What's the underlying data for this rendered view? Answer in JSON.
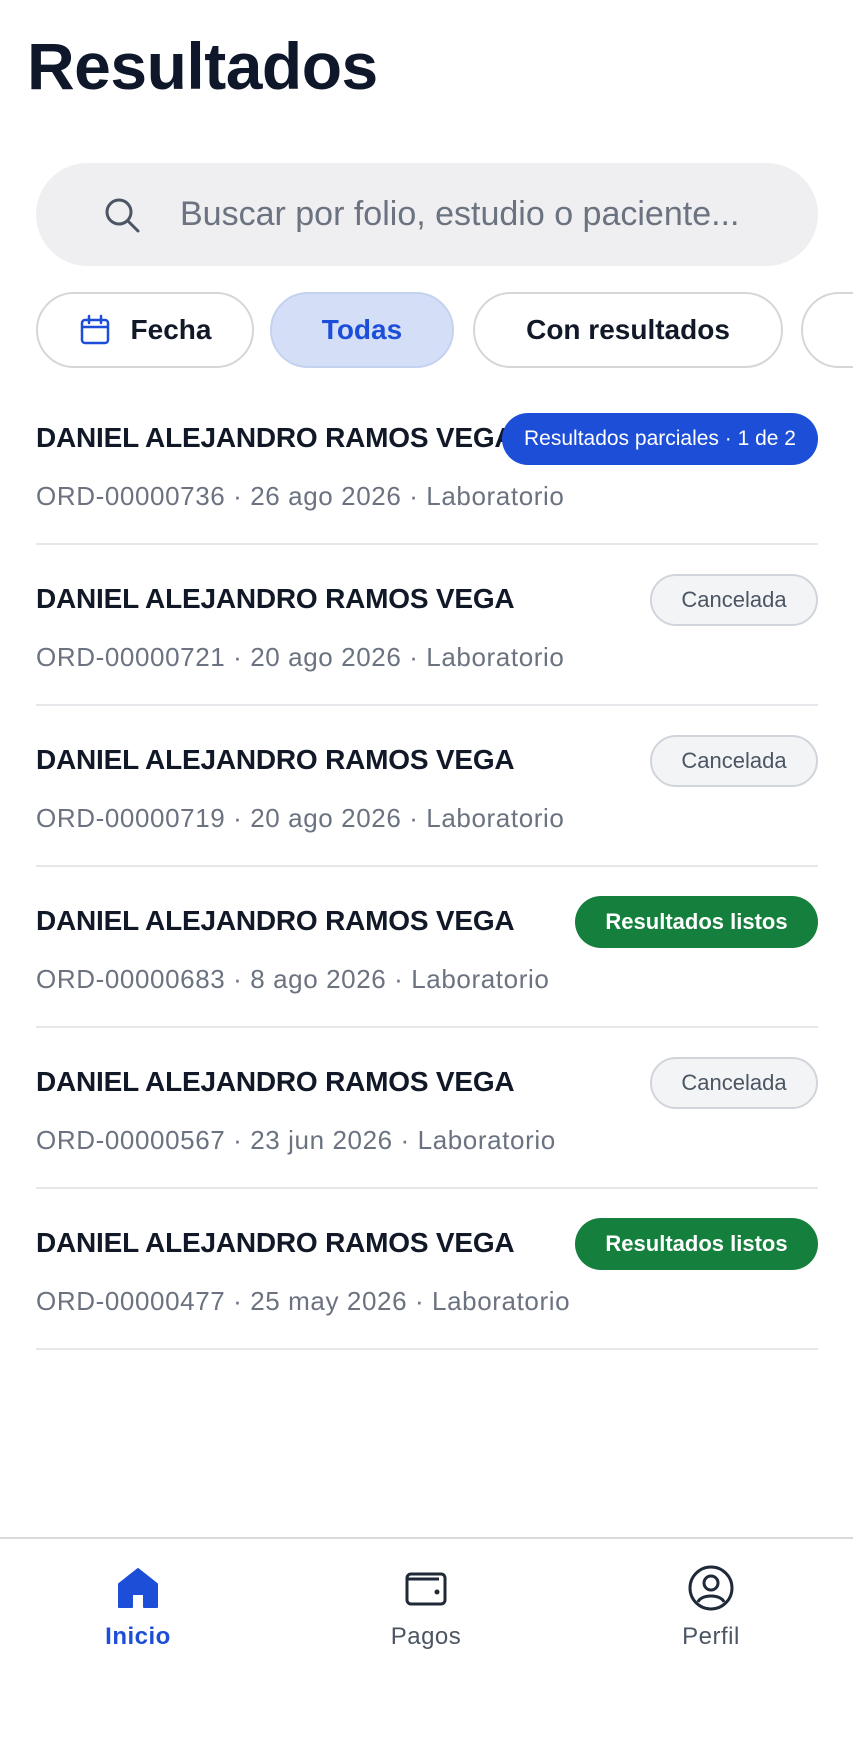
{
  "header": {
    "title": "Resultados"
  },
  "search": {
    "placeholder": "Buscar por folio, estudio o paciente...",
    "icon": "search-icon"
  },
  "filters": {
    "fecha_label": "Fecha",
    "todas_label": "Todas",
    "con_resultados_label": "Con resultados",
    "active": "Todas",
    "accent_color": "#1d4ed8"
  },
  "orders": [
    {
      "patient": "DANIEL ALEJANDRO RAMOS VEGA",
      "meta": "ORD-00000736 · 26 ago 2026 · Laboratorio",
      "status": "Resultados parciales · 1 de 2",
      "status_type": "partial"
    },
    {
      "patient": "DANIEL ALEJANDRO RAMOS VEGA",
      "meta": "ORD-00000721 · 20 ago 2026 · Laboratorio",
      "status": "Cancelada",
      "status_type": "cancel"
    },
    {
      "patient": "DANIEL ALEJANDRO RAMOS VEGA",
      "meta": "ORD-00000719 · 20 ago 2026 · Laboratorio",
      "status": "Cancelada",
      "status_type": "cancel"
    },
    {
      "patient": "DANIEL ALEJANDRO RAMOS VEGA",
      "meta": "ORD-00000683 · 8 ago 2026 · Laboratorio",
      "status": "Resultados listos",
      "status_type": "ready"
    },
    {
      "patient": "DANIEL ALEJANDRO RAMOS VEGA",
      "meta": "ORD-00000567 · 23 jun 2026 · Laboratorio",
      "status": "Cancelada",
      "status_type": "cancel"
    },
    {
      "patient": "DANIEL ALEJANDRO RAMOS VEGA",
      "meta": "ORD-00000477 · 25 may 2026 · Laboratorio",
      "status": "Resultados listos",
      "status_type": "ready"
    }
  ],
  "tabbar": {
    "inicio_label": "Inicio",
    "pagos_label": "Pagos",
    "perfil_label": "Perfil",
    "active": "Inicio"
  },
  "colors": {
    "partial": "#1d4ed8",
    "ready": "#15803d",
    "cancel_bg": "#f3f4f6"
  }
}
